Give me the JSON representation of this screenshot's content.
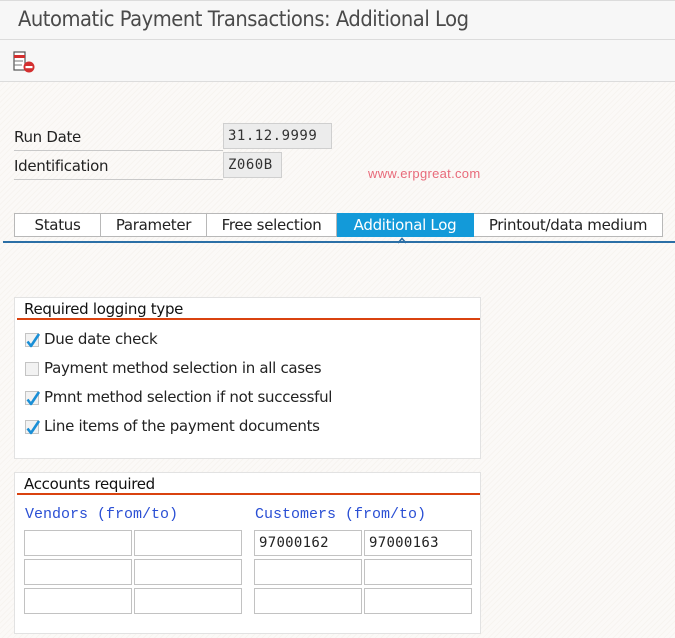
{
  "window": {
    "title": "Automatic Payment Transactions: Additional Log"
  },
  "toolbar": {
    "buttons": [
      {
        "icon": "delete-log-icon",
        "tooltip": ""
      }
    ]
  },
  "header_fields": {
    "run_date": {
      "label": "Run Date",
      "value": "31.12.9999"
    },
    "identification": {
      "label": "Identification",
      "value": "Z060B"
    }
  },
  "watermark": "www.erpgreat.com",
  "tabs": [
    {
      "label": "Status",
      "active": false
    },
    {
      "label": "Parameter",
      "active": false
    },
    {
      "label": "Free selection",
      "active": false
    },
    {
      "label": "Additional Log",
      "active": true
    },
    {
      "label": "Printout/data medium",
      "active": false
    }
  ],
  "logging_group": {
    "title": "Required logging type",
    "options": [
      {
        "label": "Due date check",
        "checked": true
      },
      {
        "label": "Payment method selection in all cases",
        "checked": false
      },
      {
        "label": "Pmnt method selection if not successful",
        "checked": true
      },
      {
        "label": "Line items of the payment documents",
        "checked": true
      }
    ]
  },
  "accounts_group": {
    "title": "Accounts required",
    "vendors_header": "Vendors (from/to)",
    "customers_header": "Customers (from/to)",
    "vendors": [
      {
        "from": "",
        "to": ""
      },
      {
        "from": "",
        "to": ""
      },
      {
        "from": "",
        "to": ""
      }
    ],
    "customers": [
      {
        "from": "97000162",
        "to": "97000163"
      },
      {
        "from": "",
        "to": ""
      },
      {
        "from": "",
        "to": ""
      }
    ]
  },
  "colors": {
    "active_tab": "#139ad9",
    "group_underline": "#d9420f",
    "column_header": "#2a4fd4",
    "checkmark": "#1a8fd6",
    "watermark": "#e86a7a"
  }
}
